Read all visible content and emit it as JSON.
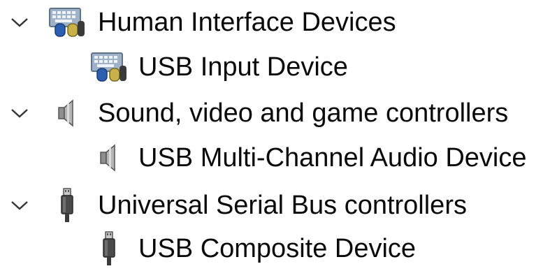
{
  "tree": {
    "categories": [
      {
        "label": "Human Interface Devices",
        "icon": "keyboard-mouse-icon",
        "expanded": true,
        "children": [
          {
            "label": "USB Input Device",
            "icon": "keyboard-mouse-icon"
          }
        ]
      },
      {
        "label": "Sound, video and game controllers",
        "icon": "speaker-icon",
        "expanded": true,
        "children": [
          {
            "label": "USB Multi-Channel Audio Device",
            "icon": "speaker-icon"
          }
        ]
      },
      {
        "label": "Universal Serial Bus controllers",
        "icon": "usb-plug-icon",
        "expanded": true,
        "children": [
          {
            "label": "USB Composite Device",
            "icon": "usb-plug-icon"
          }
        ]
      }
    ]
  }
}
